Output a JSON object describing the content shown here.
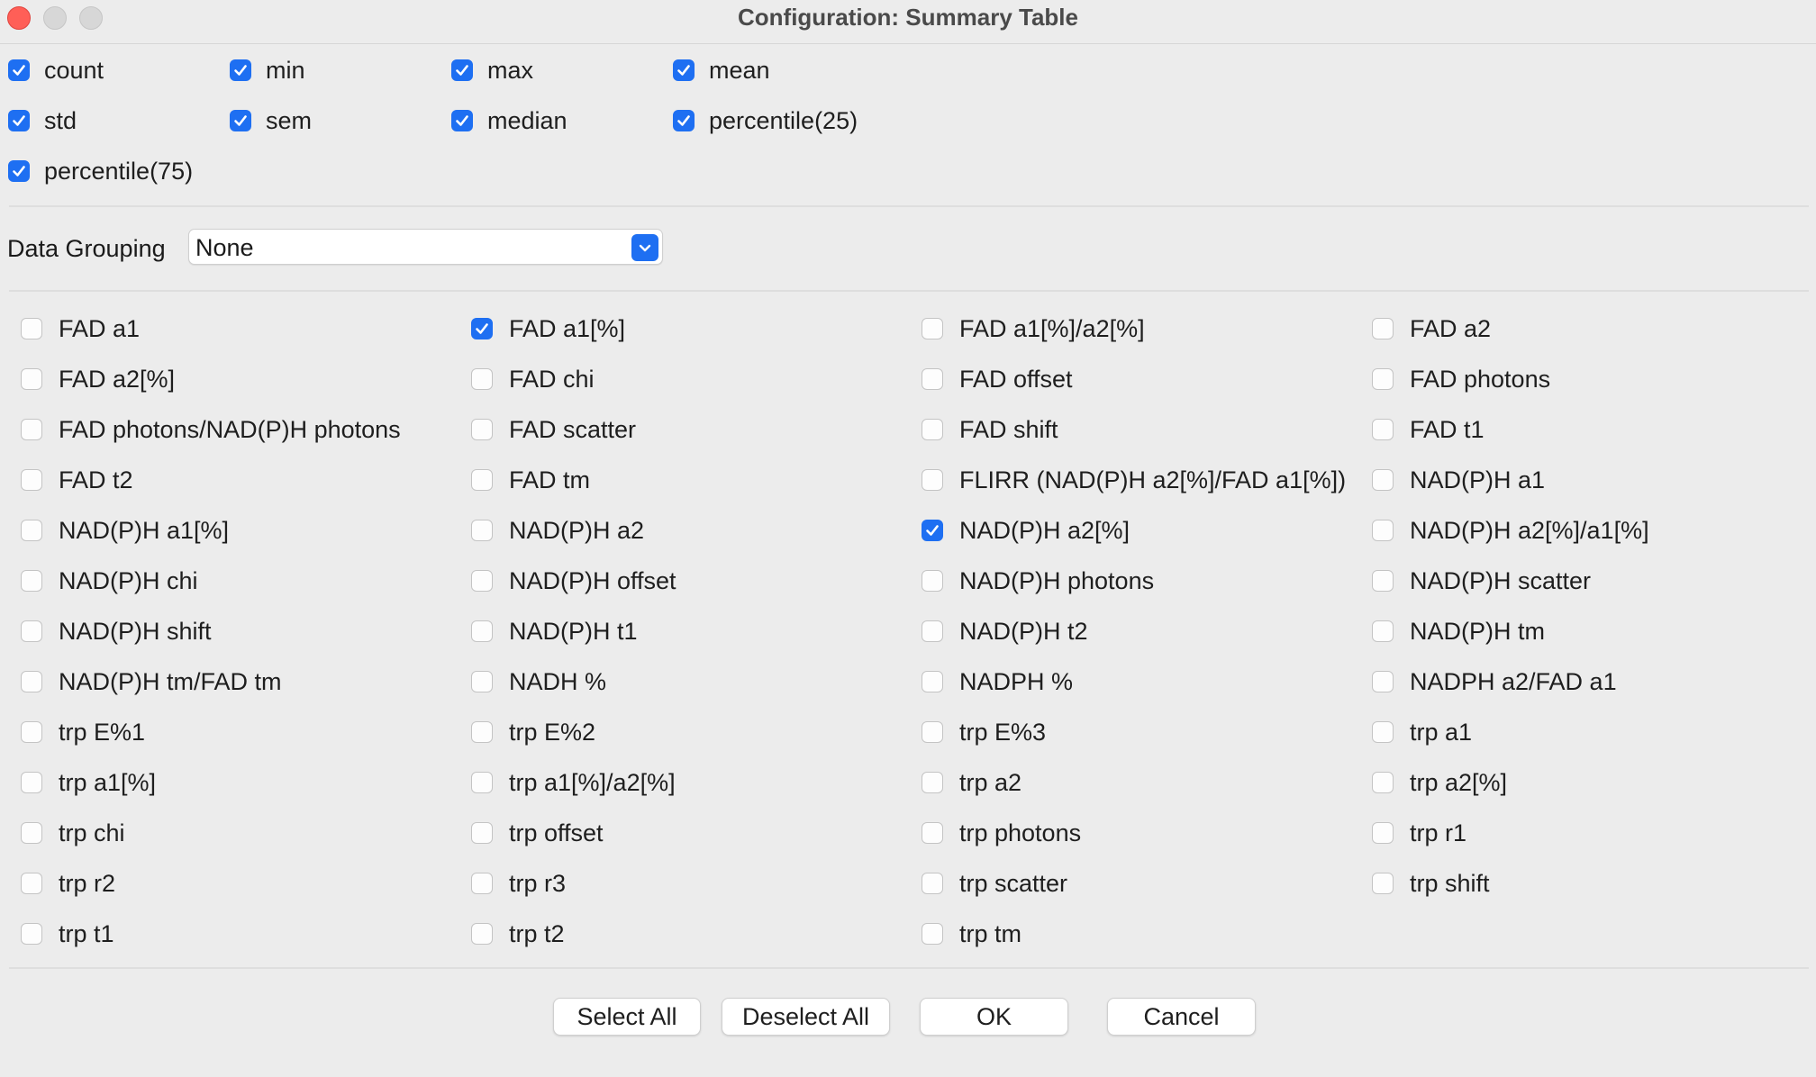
{
  "window": {
    "title": "Configuration: Summary Table"
  },
  "statistics": [
    {
      "label": "count",
      "checked": true
    },
    {
      "label": "min",
      "checked": true
    },
    {
      "label": "max",
      "checked": true
    },
    {
      "label": "mean",
      "checked": true
    },
    {
      "label": "std",
      "checked": true
    },
    {
      "label": "sem",
      "checked": true
    },
    {
      "label": "median",
      "checked": true
    },
    {
      "label": "percentile(25)",
      "checked": true
    },
    {
      "label": "percentile(75)",
      "checked": true
    }
  ],
  "grouping": {
    "label": "Data Grouping",
    "value": "None"
  },
  "variables": [
    {
      "label": "FAD a1",
      "checked": false
    },
    {
      "label": "FAD a1[%]",
      "checked": true
    },
    {
      "label": "FAD a1[%]/a2[%]",
      "checked": false
    },
    {
      "label": "FAD a2",
      "checked": false
    },
    {
      "label": "FAD a2[%]",
      "checked": false
    },
    {
      "label": "FAD chi",
      "checked": false
    },
    {
      "label": "FAD offset",
      "checked": false
    },
    {
      "label": "FAD photons",
      "checked": false
    },
    {
      "label": "FAD photons/NAD(P)H photons",
      "checked": false
    },
    {
      "label": "FAD scatter",
      "checked": false
    },
    {
      "label": "FAD shift",
      "checked": false
    },
    {
      "label": "FAD t1",
      "checked": false
    },
    {
      "label": "FAD t2",
      "checked": false
    },
    {
      "label": "FAD tm",
      "checked": false
    },
    {
      "label": "FLIRR (NAD(P)H a2[%]/FAD a1[%])",
      "checked": false
    },
    {
      "label": "NAD(P)H a1",
      "checked": false
    },
    {
      "label": "NAD(P)H a1[%]",
      "checked": false
    },
    {
      "label": "NAD(P)H a2",
      "checked": false
    },
    {
      "label": "NAD(P)H a2[%]",
      "checked": true
    },
    {
      "label": "NAD(P)H a2[%]/a1[%]",
      "checked": false
    },
    {
      "label": "NAD(P)H chi",
      "checked": false
    },
    {
      "label": "NAD(P)H offset",
      "checked": false
    },
    {
      "label": "NAD(P)H photons",
      "checked": false
    },
    {
      "label": "NAD(P)H scatter",
      "checked": false
    },
    {
      "label": "NAD(P)H shift",
      "checked": false
    },
    {
      "label": "NAD(P)H t1",
      "checked": false
    },
    {
      "label": "NAD(P)H t2",
      "checked": false
    },
    {
      "label": "NAD(P)H tm",
      "checked": false
    },
    {
      "label": "NAD(P)H tm/FAD tm",
      "checked": false
    },
    {
      "label": "NADH %",
      "checked": false
    },
    {
      "label": "NADPH %",
      "checked": false
    },
    {
      "label": "NADPH a2/FAD a1",
      "checked": false
    },
    {
      "label": "trp E%1",
      "checked": false
    },
    {
      "label": "trp E%2",
      "checked": false
    },
    {
      "label": "trp E%3",
      "checked": false
    },
    {
      "label": "trp a1",
      "checked": false
    },
    {
      "label": "trp a1[%]",
      "checked": false
    },
    {
      "label": "trp a1[%]/a2[%]",
      "checked": false
    },
    {
      "label": "trp a2",
      "checked": false
    },
    {
      "label": "trp a2[%]",
      "checked": false
    },
    {
      "label": "trp chi",
      "checked": false
    },
    {
      "label": "trp offset",
      "checked": false
    },
    {
      "label": "trp photons",
      "checked": false
    },
    {
      "label": "trp r1",
      "checked": false
    },
    {
      "label": "trp r2",
      "checked": false
    },
    {
      "label": "trp r3",
      "checked": false
    },
    {
      "label": "trp scatter",
      "checked": false
    },
    {
      "label": "trp shift",
      "checked": false
    },
    {
      "label": "trp t1",
      "checked": false
    },
    {
      "label": "trp t2",
      "checked": false
    },
    {
      "label": "trp tm",
      "checked": false
    }
  ],
  "buttons": {
    "select_all": "Select All",
    "deselect_all": "Deselect All",
    "ok": "OK",
    "cancel": "Cancel"
  },
  "colors": {
    "accent": "#1e6ff2",
    "close": "#ff5f57",
    "background": "#ececec"
  }
}
